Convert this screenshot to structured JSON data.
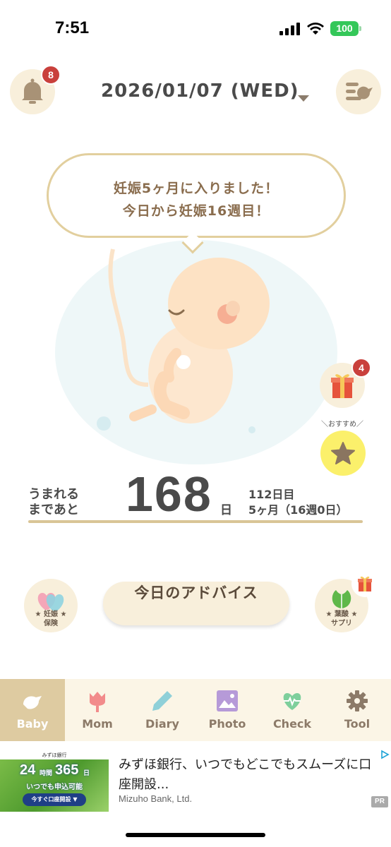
{
  "status_bar": {
    "time": "7:51",
    "battery": "100"
  },
  "header": {
    "date": "2026/01/07 (WED)",
    "notification_count": "8"
  },
  "speech_bubble": {
    "line1": "妊娠5ヶ月に入りました！",
    "line2": "今日から妊娠16週目！"
  },
  "side_buttons": {
    "gift_count": "4",
    "recommend_label": "＼おすすめ／"
  },
  "countdown": {
    "label_line1": "うまれる",
    "label_line2": "まであと",
    "days_remaining": "168",
    "unit": "日",
    "day_count": "112日目",
    "month_week": "5ヶ月（16週0日）"
  },
  "actions": {
    "insurance_line1": "★ 妊娠 ★",
    "insurance_line2": "保険",
    "advice_label": "今日のアドバイス",
    "supplement_line1": "★ 葉酸 ★",
    "supplement_line2": "サプリ"
  },
  "tabs": [
    {
      "label": "Baby",
      "icon": "baby-bird-icon",
      "active": true
    },
    {
      "label": "Mom",
      "icon": "tulip-icon",
      "active": false
    },
    {
      "label": "Diary",
      "icon": "pencil-icon",
      "active": false
    },
    {
      "label": "Photo",
      "icon": "photo-icon",
      "active": false
    },
    {
      "label": "Check",
      "icon": "heartbeat-icon",
      "active": false
    },
    {
      "label": "Tool",
      "icon": "gear-icon",
      "active": false
    }
  ],
  "ad": {
    "image_header": "みずほ銀行",
    "big_24": "24",
    "jikan": "時間",
    "big_365": "365",
    "nichi": "日",
    "image_mid": "いつでも申込可能",
    "image_cta": "今すぐ口座開設 ▼",
    "title": "みずほ銀行、いつでもどこでもスムーズに口座開設...",
    "advertiser": "Mizuho Bank, Ltd.",
    "pr": "PR"
  },
  "colors": {
    "accent_beige": "#decba1",
    "button_cream": "#f8efdb",
    "badge_red": "#c9403c",
    "star_yellow": "#fbf06b"
  }
}
